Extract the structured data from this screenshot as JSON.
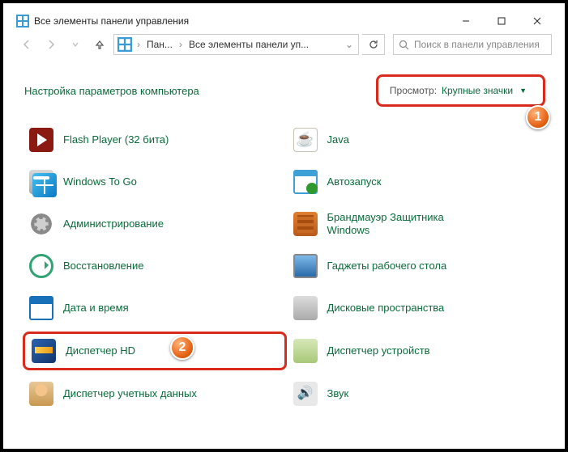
{
  "window": {
    "title": "Все элементы панели управления"
  },
  "breadcrumb": {
    "root": "Пан...",
    "current": "Все элементы панели уп..."
  },
  "search": {
    "placeholder": "Поиск в панели управления"
  },
  "heading": "Настройка параметров компьютера",
  "view": {
    "label": "Просмотр:",
    "value": "Крупные значки"
  },
  "items": {
    "left": [
      {
        "label": "Flash Player (32 бита)"
      },
      {
        "label": "Windows To Go"
      },
      {
        "label": "Администрирование"
      },
      {
        "label": "Восстановление"
      },
      {
        "label": "Дата и время"
      },
      {
        "label": "Диспетчер HD"
      },
      {
        "label": "Диспетчер учетных данных"
      }
    ],
    "right": [
      {
        "label": "Java"
      },
      {
        "label": "Автозапуск"
      },
      {
        "label": "Брандмауэр Защитника Windows"
      },
      {
        "label": "Гаджеты рабочего стола"
      },
      {
        "label": "Дисковые пространства"
      },
      {
        "label": "Диспетчер устройств"
      },
      {
        "label": "Звук"
      }
    ]
  },
  "annotations": {
    "badge1": "1",
    "badge2": "2"
  }
}
